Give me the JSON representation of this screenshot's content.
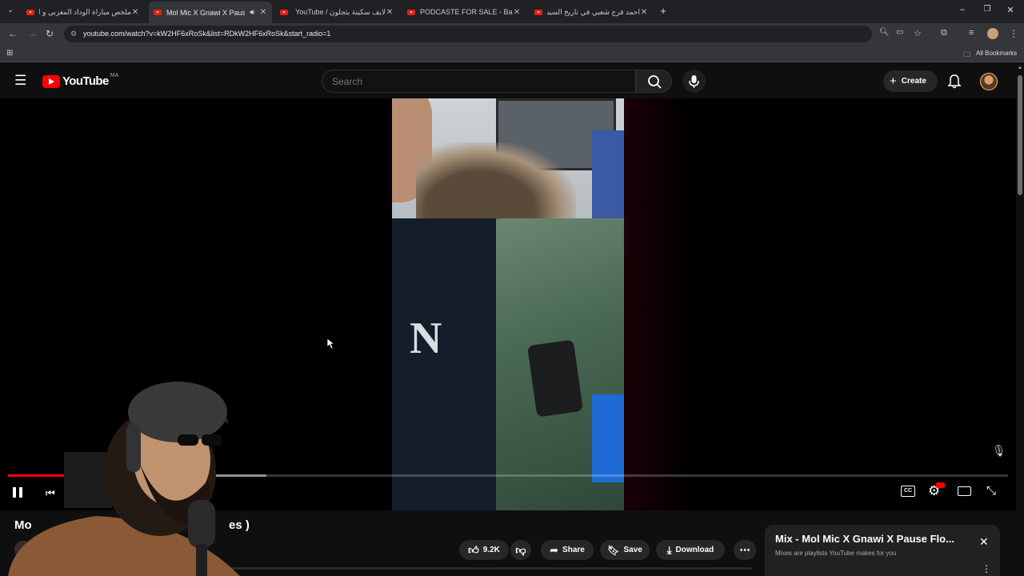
{
  "browser": {
    "tabs": [
      {
        "title": "ملخص مباراة الوداد المغربي و او",
        "active": false
      },
      {
        "title": "Mol Mic X Gnawi X Pause F",
        "active": true
      },
      {
        "title": "لايف سكينة بتجلون / YouTube",
        "active": false
      },
      {
        "title": "PODCASTE FOR SALE - Bassou",
        "active": false
      },
      {
        "title": "احمد فرج شعبي في تاريخ السينما",
        "active": false
      }
    ],
    "url": "youtube.com/watch?v=kW2HF6xRoSk&list=RDkW2HF6xRoSk&start_radio=1",
    "bookmarks_label": "All Bookmarks"
  },
  "youtube": {
    "logo_text": "YouTube",
    "country_code": "MA",
    "search_placeholder": "Search",
    "create_label": "Create"
  },
  "player": {
    "progress_played_fraction": 0.058,
    "progress_buffered_fraction": 0.258
  },
  "video": {
    "title_visible_start": "Mo",
    "title_visible_end": "es )"
  },
  "actions": {
    "like_count": "9.2K",
    "share_label": "Share",
    "save_label": "Save",
    "download_label": "Download"
  },
  "mix": {
    "title": "Mix - Mol Mic X Gnawi X Pause Flo...",
    "subtitle": "Mixes are playlists YouTube makes for you"
  },
  "colors": {
    "accent_red": "#ff0000",
    "background": "#0f0f0f",
    "chrome_dark": "#202124",
    "chrome_light": "#35363a"
  }
}
